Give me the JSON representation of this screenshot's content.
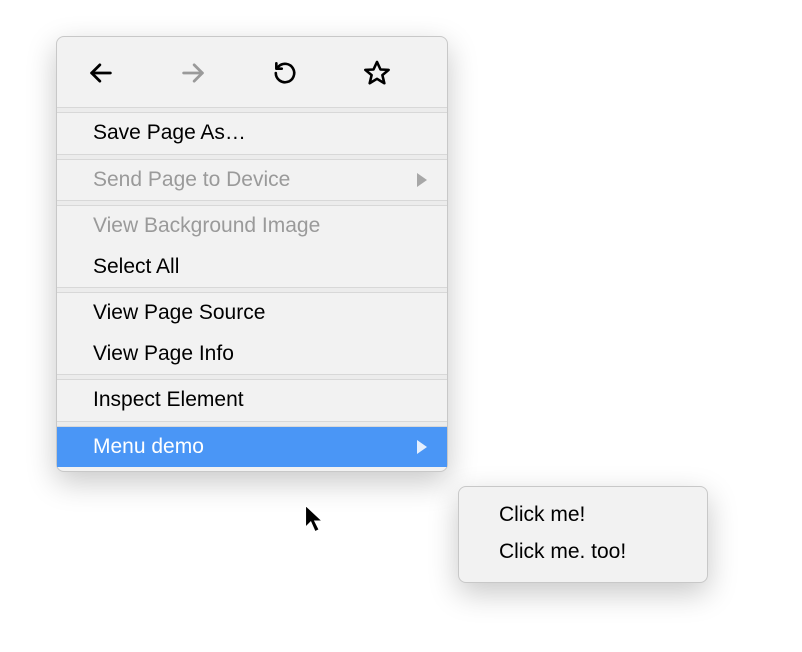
{
  "menu": {
    "save_page_as": "Save Page As…",
    "send_page_to_device": "Send Page to Device",
    "view_background_image": "View Background Image",
    "select_all": "Select All",
    "view_page_source": "View Page Source",
    "view_page_info": "View Page Info",
    "inspect_element": "Inspect Element",
    "menu_demo": "Menu demo"
  },
  "submenu": {
    "click_me": "Click me!",
    "click_me_too": "Click me. too!"
  }
}
